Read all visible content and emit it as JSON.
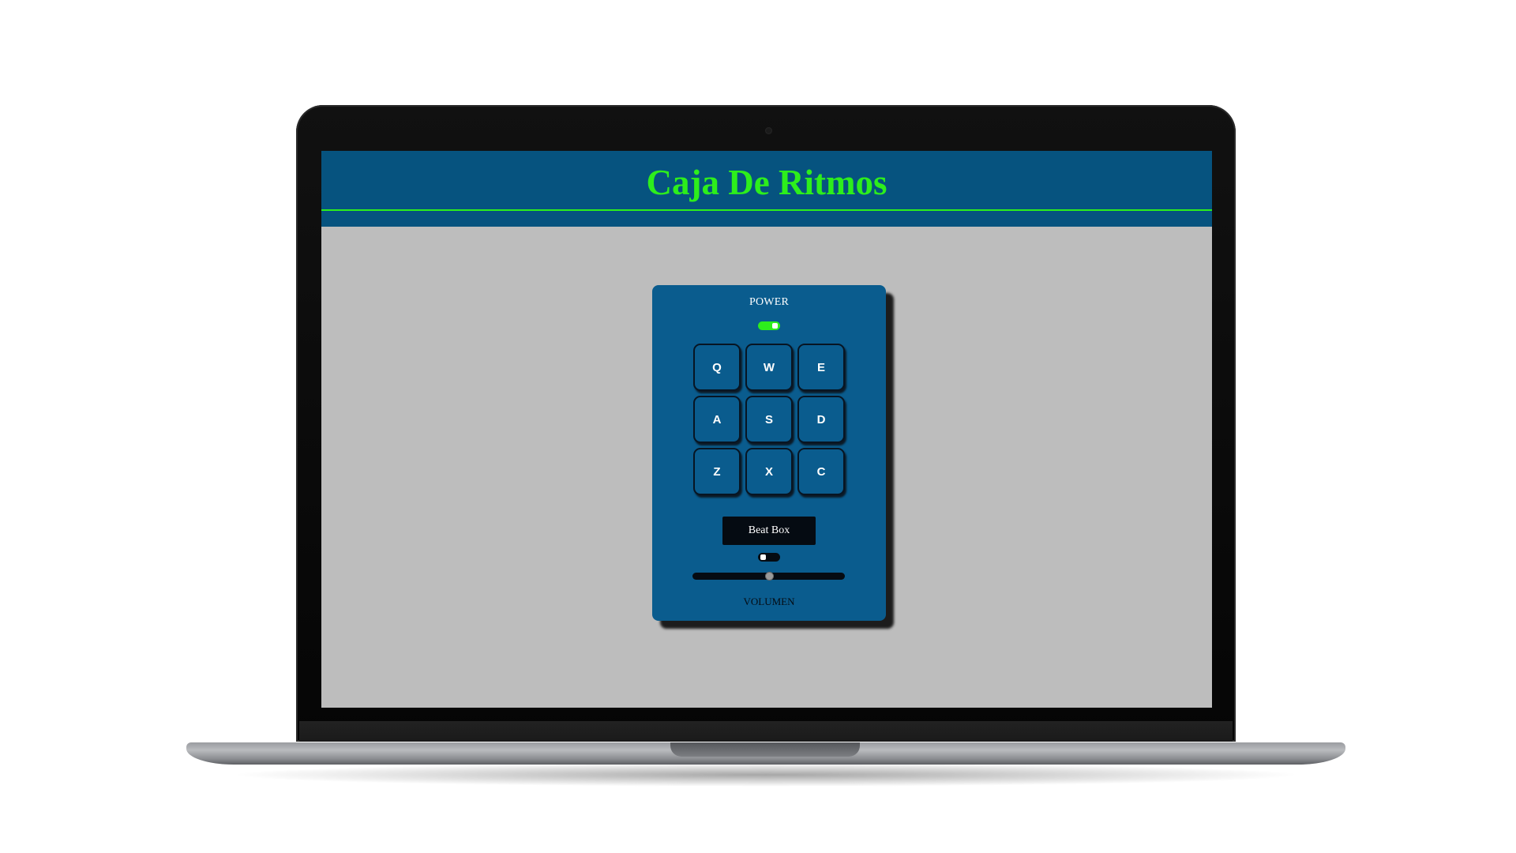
{
  "app": {
    "title": "Caja De Ritmos",
    "accent_color": "#2dee1c",
    "header_color": "#06537f",
    "background_color": "#bdbdbd"
  },
  "drum_machine": {
    "power_label": "POWER",
    "power_on": true,
    "pads": [
      {
        "key": "Q"
      },
      {
        "key": "W"
      },
      {
        "key": "E"
      },
      {
        "key": "A"
      },
      {
        "key": "S"
      },
      {
        "key": "D"
      },
      {
        "key": "Z"
      },
      {
        "key": "X"
      },
      {
        "key": "C"
      }
    ],
    "display_text": "Beat Box",
    "bank_toggle_on": false,
    "volume_label": "VOLUMEN",
    "volume_value": 0.5
  },
  "device": {
    "frame": "laptop"
  }
}
